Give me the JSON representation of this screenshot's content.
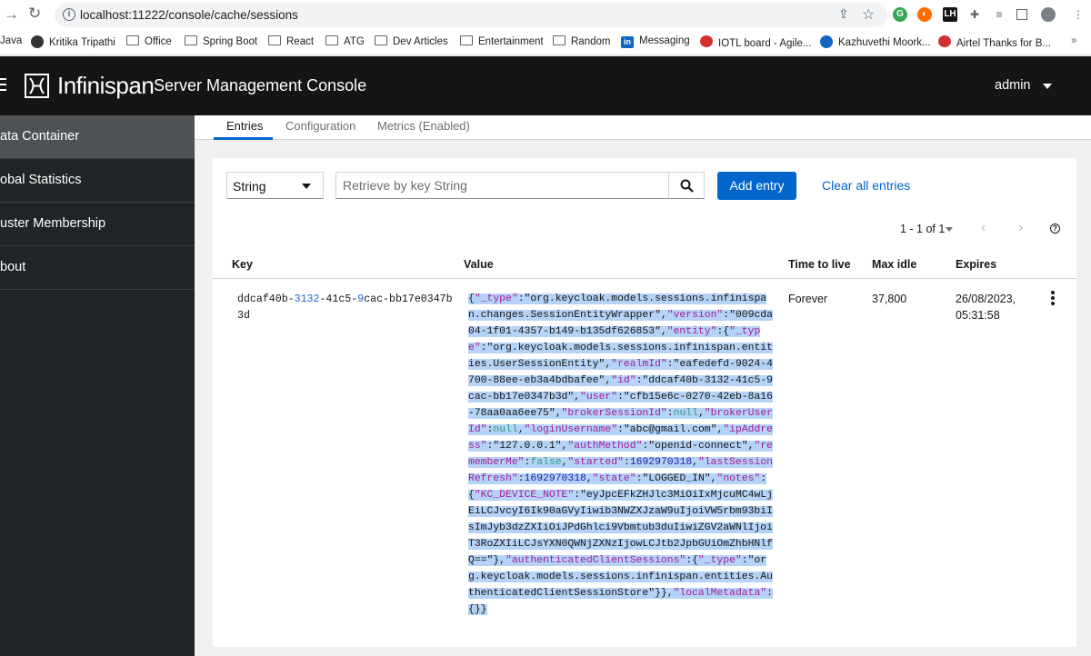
{
  "browser": {
    "url": "localhost:11222/console/cache/sessions",
    "bookmarks": [
      "Java",
      "Kritika Tripathi",
      "Office",
      "Spring Boot",
      "React",
      "ATG",
      "Dev Articles",
      "Entertainment",
      "Random",
      "Messaging",
      "IOTL board - Agile...",
      "Kazhuvethi Moork...",
      "Airtel Thanks for B..."
    ]
  },
  "masthead": {
    "brand": "Infinispan",
    "title": "Server Management Console",
    "user": "admin"
  },
  "sidebar": {
    "items": [
      {
        "label": "ata Container",
        "active": true
      },
      {
        "label": "obal Statistics",
        "active": false
      },
      {
        "label": "uster Membership",
        "active": false
      },
      {
        "label": "bout",
        "active": false
      }
    ]
  },
  "tabs": [
    {
      "label": "Entries",
      "active": true
    },
    {
      "label": "Configuration",
      "active": false
    },
    {
      "label": "Metrics (Enabled)",
      "active": false
    }
  ],
  "toolbar": {
    "key_type": "String",
    "search_placeholder": "Retrieve by key String",
    "add_label": "Add entry",
    "clear_label": "Clear all entries"
  },
  "pagination": {
    "range": "1 - 1 of 1"
  },
  "table": {
    "columns": [
      "Key",
      "Value",
      "Time to live",
      "Max idle",
      "Expires"
    ],
    "rows": [
      {
        "key_parts": [
          {
            "t": "ddcaf40b-",
            "c": ""
          },
          {
            "t": "3132",
            "c": "hl"
          },
          {
            "t": "-41",
            "c": ""
          },
          {
            "t": "c5-",
            "c": ""
          },
          {
            "t": "9",
            "c": "hl"
          },
          {
            "t": "cac-bb17e0347b3d",
            "c": ""
          }
        ],
        "value_tokens": [
          {
            "t": "{",
            "c": "p"
          },
          {
            "t": "\"_type\"",
            "c": "key"
          },
          {
            "t": ":",
            "c": "p"
          },
          {
            "t": "\"org.keycloak.models.sessions.infinispan.changes.SessionEntityWrapper\"",
            "c": "str"
          },
          {
            "t": ",",
            "c": "p"
          },
          {
            "t": "\"version\"",
            "c": "key"
          },
          {
            "t": ":",
            "c": "p"
          },
          {
            "t": "\"009cda04-1f01-4357-b149-b135df626853\"",
            "c": "str"
          },
          {
            "t": ",",
            "c": "p"
          },
          {
            "t": "\"entity\"",
            "c": "key"
          },
          {
            "t": ":{",
            "c": "p"
          },
          {
            "t": "\"_type\"",
            "c": "key"
          },
          {
            "t": ":",
            "c": "p"
          },
          {
            "t": "\"org.keycloak.models.sessions.infinispan.entities.UserSessionEntity\"",
            "c": "str"
          },
          {
            "t": ",",
            "c": "p"
          },
          {
            "t": "\"realmId\"",
            "c": "key"
          },
          {
            "t": ":",
            "c": "p"
          },
          {
            "t": "\"eafedefd-9024-4700-88ee-eb3a4bdbafee\"",
            "c": "str"
          },
          {
            "t": ",",
            "c": "p"
          },
          {
            "t": "\"id\"",
            "c": "key"
          },
          {
            "t": ":",
            "c": "p"
          },
          {
            "t": "\"ddcaf40b-3132-41c5-9cac-bb17e0347b3d\"",
            "c": "str"
          },
          {
            "t": ",",
            "c": "p"
          },
          {
            "t": "\"user\"",
            "c": "key"
          },
          {
            "t": ":",
            "c": "p"
          },
          {
            "t": "\"cfb15e6c-0270-42eb-8a16-78aa0aa6ee75\"",
            "c": "str"
          },
          {
            "t": ",",
            "c": "p"
          },
          {
            "t": "\"brokerSessionId\"",
            "c": "key"
          },
          {
            "t": ":",
            "c": "p"
          },
          {
            "t": "null",
            "c": "lit"
          },
          {
            "t": ",",
            "c": "p"
          },
          {
            "t": "\"brokerUserId\"",
            "c": "key"
          },
          {
            "t": ":",
            "c": "p"
          },
          {
            "t": "null",
            "c": "lit"
          },
          {
            "t": ",",
            "c": "p"
          },
          {
            "t": "\"loginUsername\"",
            "c": "key"
          },
          {
            "t": ":",
            "c": "p"
          },
          {
            "t": "\"abc@gmail.com\"",
            "c": "str"
          },
          {
            "t": ",",
            "c": "p"
          },
          {
            "t": "\"ipAddress\"",
            "c": "key"
          },
          {
            "t": ":",
            "c": "p"
          },
          {
            "t": "\"127.0.0.1\"",
            "c": "str"
          },
          {
            "t": ",",
            "c": "p"
          },
          {
            "t": "\"authMethod\"",
            "c": "key"
          },
          {
            "t": ":",
            "c": "p"
          },
          {
            "t": "\"openid-connect\"",
            "c": "str"
          },
          {
            "t": ",",
            "c": "p"
          },
          {
            "t": "\"rememberMe\"",
            "c": "key"
          },
          {
            "t": ":",
            "c": "p"
          },
          {
            "t": "false",
            "c": "lit"
          },
          {
            "t": ",",
            "c": "p"
          },
          {
            "t": "\"started\"",
            "c": "key"
          },
          {
            "t": ":",
            "c": "p"
          },
          {
            "t": "1692970318",
            "c": "num"
          },
          {
            "t": ",",
            "c": "p"
          },
          {
            "t": "\"lastSessionRefresh\"",
            "c": "key"
          },
          {
            "t": ":",
            "c": "p"
          },
          {
            "t": "1692970318",
            "c": "num"
          },
          {
            "t": ",",
            "c": "p"
          },
          {
            "t": "\"state\"",
            "c": "key"
          },
          {
            "t": ":",
            "c": "p"
          },
          {
            "t": "\"LOGGED_IN\"",
            "c": "str"
          },
          {
            "t": ",",
            "c": "p"
          },
          {
            "t": "\"notes\"",
            "c": "key"
          },
          {
            "t": ":{",
            "c": "p"
          },
          {
            "t": "\"KC_DEVICE_NOTE\"",
            "c": "key"
          },
          {
            "t": ":",
            "c": "p"
          },
          {
            "t": "\"eyJpcEFkZHJlc3MiOiIxMjcuMC4wLjEiLCJvcyI6Ik90aGVyIiwib3NWZXJzaW9uIjoiVW5rbm93biIsImJyb3dzZXIiOiJPdGhlci9Vbmtub3duIiwiZGV2aWNlIjoiT3RoZXIiLCJsYXN0QWNjZXNzIjowLCJtb2JpbGUiOmZhbHNlfQ==\"",
            "c": "str"
          },
          {
            "t": "},",
            "c": "p"
          },
          {
            "t": "\"authenticatedClientSessions\"",
            "c": "key"
          },
          {
            "t": ":{",
            "c": "p"
          },
          {
            "t": "\"_type\"",
            "c": "key"
          },
          {
            "t": ":",
            "c": "p"
          },
          {
            "t": "\"org.keycloak.models.sessions.infinispan.entities.AuthenticatedClientSessionStore\"",
            "c": "str"
          },
          {
            "t": "}},",
            "c": "p"
          },
          {
            "t": "\"localMetadata\"",
            "c": "key"
          },
          {
            "t": ":{}}",
            "c": "p"
          }
        ],
        "ttl": "Forever",
        "max_idle": "37,800",
        "expires": "26/08/2023, 05:31:58"
      }
    ]
  }
}
